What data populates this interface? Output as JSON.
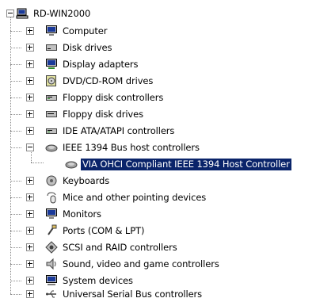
{
  "root": {
    "label": "RD-WIN2000",
    "icon": "computer-icon"
  },
  "categories": [
    {
      "label": "Computer",
      "icon": "monitor-icon"
    },
    {
      "label": "Disk drives",
      "icon": "disk-drive-icon"
    },
    {
      "label": "Display adapters",
      "icon": "display-adapter-icon"
    },
    {
      "label": "DVD/CD-ROM drives",
      "icon": "cdrom-icon"
    },
    {
      "label": "Floppy disk controllers",
      "icon": "floppy-controller-icon"
    },
    {
      "label": "Floppy disk drives",
      "icon": "floppy-drive-icon"
    },
    {
      "label": "IDE ATA/ATAPI controllers",
      "icon": "ide-controller-icon"
    },
    {
      "label": "IEEE 1394 Bus host controllers",
      "icon": "ieee1394-icon",
      "expanded": true,
      "children": [
        {
          "label": "VIA OHCI Compliant IEEE 1394 Host Controller",
          "icon": "ieee1394-device-icon",
          "selected": true
        }
      ]
    },
    {
      "label": "Keyboards",
      "icon": "keyboard-icon"
    },
    {
      "label": "Mice and other pointing devices",
      "icon": "mouse-icon"
    },
    {
      "label": "Monitors",
      "icon": "monitor-icon"
    },
    {
      "label": "Ports (COM & LPT)",
      "icon": "port-icon"
    },
    {
      "label": "SCSI and RAID controllers",
      "icon": "scsi-icon"
    },
    {
      "label": "Sound, video and game controllers",
      "icon": "sound-icon"
    },
    {
      "label": "System devices",
      "icon": "system-icon"
    },
    {
      "label": "Universal Serial Bus controllers",
      "icon": "usb-icon"
    }
  ],
  "colors": {
    "selection_bg": "#0a246a",
    "selection_text": "#ffffff"
  }
}
